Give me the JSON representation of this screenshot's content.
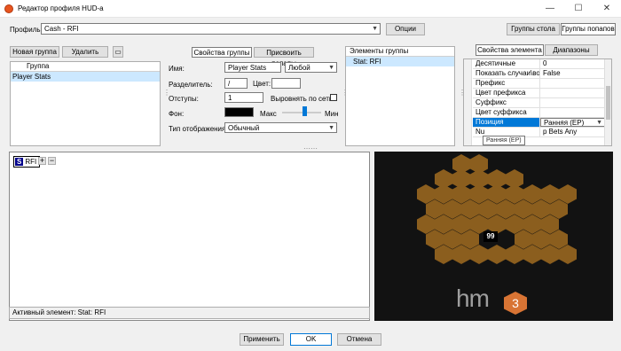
{
  "window": {
    "title": "Редактор профиля HUD-а",
    "minimize": "—",
    "maximize": "☐",
    "close": "✕"
  },
  "profile": {
    "label": "Профиль:",
    "value": "Cash - RFI",
    "options_btn": "Опции"
  },
  "top_tabs": {
    "table_groups": "Группы стола",
    "popup_groups": "Группы попапов"
  },
  "left": {
    "new_group": "Новая группа",
    "delete": "Удалить",
    "list_header": "Группа",
    "items": [
      "Player Stats"
    ]
  },
  "group_tabs": {
    "props": "Свойства группы",
    "assign": "Присвоить попапы"
  },
  "group_form": {
    "name_label": "Имя:",
    "name_value": "Player Stats",
    "any_value": "Любой",
    "sep_label": "Разделитель:",
    "sep_value": "/",
    "color_label": "Цвет:",
    "indent_label": "Отступы:",
    "indent_value": "1",
    "align_label": "Выровнять по сетке",
    "bg_label": "Фон:",
    "max_label": "Макс",
    "min_label": "Мин",
    "display_label": "Тип отображения:",
    "display_value": "Обычный"
  },
  "elements": {
    "header": "Элементы группы",
    "items": [
      "Stat: RFI"
    ]
  },
  "elem_tabs": {
    "props": "Свойства элемента",
    "ranges": "Диапазоны цвета"
  },
  "props": [
    {
      "k": "Десятичные",
      "v": "0"
    },
    {
      "k": "Показать случаи\\возм",
      "v": "False"
    },
    {
      "k": "Префикс",
      "v": ""
    },
    {
      "k": "Цвет префикса",
      "v": ""
    },
    {
      "k": "Суффикс",
      "v": ""
    },
    {
      "k": "Цвет суффикса",
      "v": ""
    },
    {
      "k": "Позиция",
      "v": "Ранняя (EP)"
    },
    {
      "k": "Nu",
      "v": "p Bets  Any"
    }
  ],
  "tooltip": "Ранняя (EP)",
  "preview": {
    "badge_s": "S",
    "badge_text": "RFI",
    "plus": "+",
    "minus": "−",
    "status": "Активный элемент: Stat: RFI"
  },
  "hud": {
    "value": "99",
    "logo_text": "hm",
    "logo_num": "3"
  },
  "footer": {
    "apply": "Применить",
    "ok": "OK",
    "cancel": "Отмена"
  },
  "colors": {
    "accent": "#0078d7",
    "hex": "#8b5e1e",
    "hud_bg": "#121212"
  }
}
